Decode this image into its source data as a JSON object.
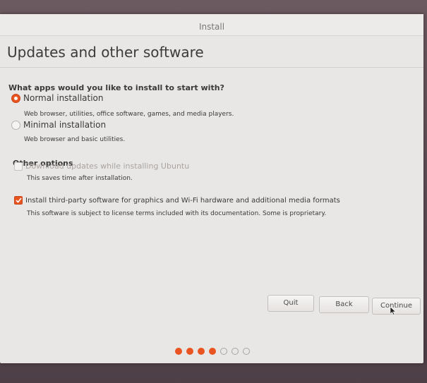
{
  "window": {
    "title": "Install"
  },
  "page": {
    "title": "Updates and other software",
    "question": "What apps would you like to install to start with?"
  },
  "install_type": {
    "options": [
      {
        "label": "Normal installation",
        "description": "Web browser, utilities, office software, games, and media players.",
        "selected": true
      },
      {
        "label": "Minimal installation",
        "description": "Web browser and basic utilities.",
        "selected": false
      }
    ]
  },
  "other_options": {
    "heading": "Other options",
    "items": [
      {
        "label": "Download updates while installing Ubuntu",
        "description": "This saves time after installation.",
        "checked": false,
        "enabled": false
      },
      {
        "label": "Install third-party software for graphics and Wi-Fi hardware and additional media formats",
        "description": "This software is subject to license terms included with its documentation. Some is proprietary.",
        "checked": true,
        "enabled": true
      }
    ]
  },
  "buttons": {
    "quit": "Quit",
    "back": "Back",
    "continue": "Continue"
  },
  "progress": {
    "completed_steps": 4,
    "total_steps": 7
  },
  "colors": {
    "accent": "#e95420",
    "window_bg": "#e9e7e6"
  }
}
